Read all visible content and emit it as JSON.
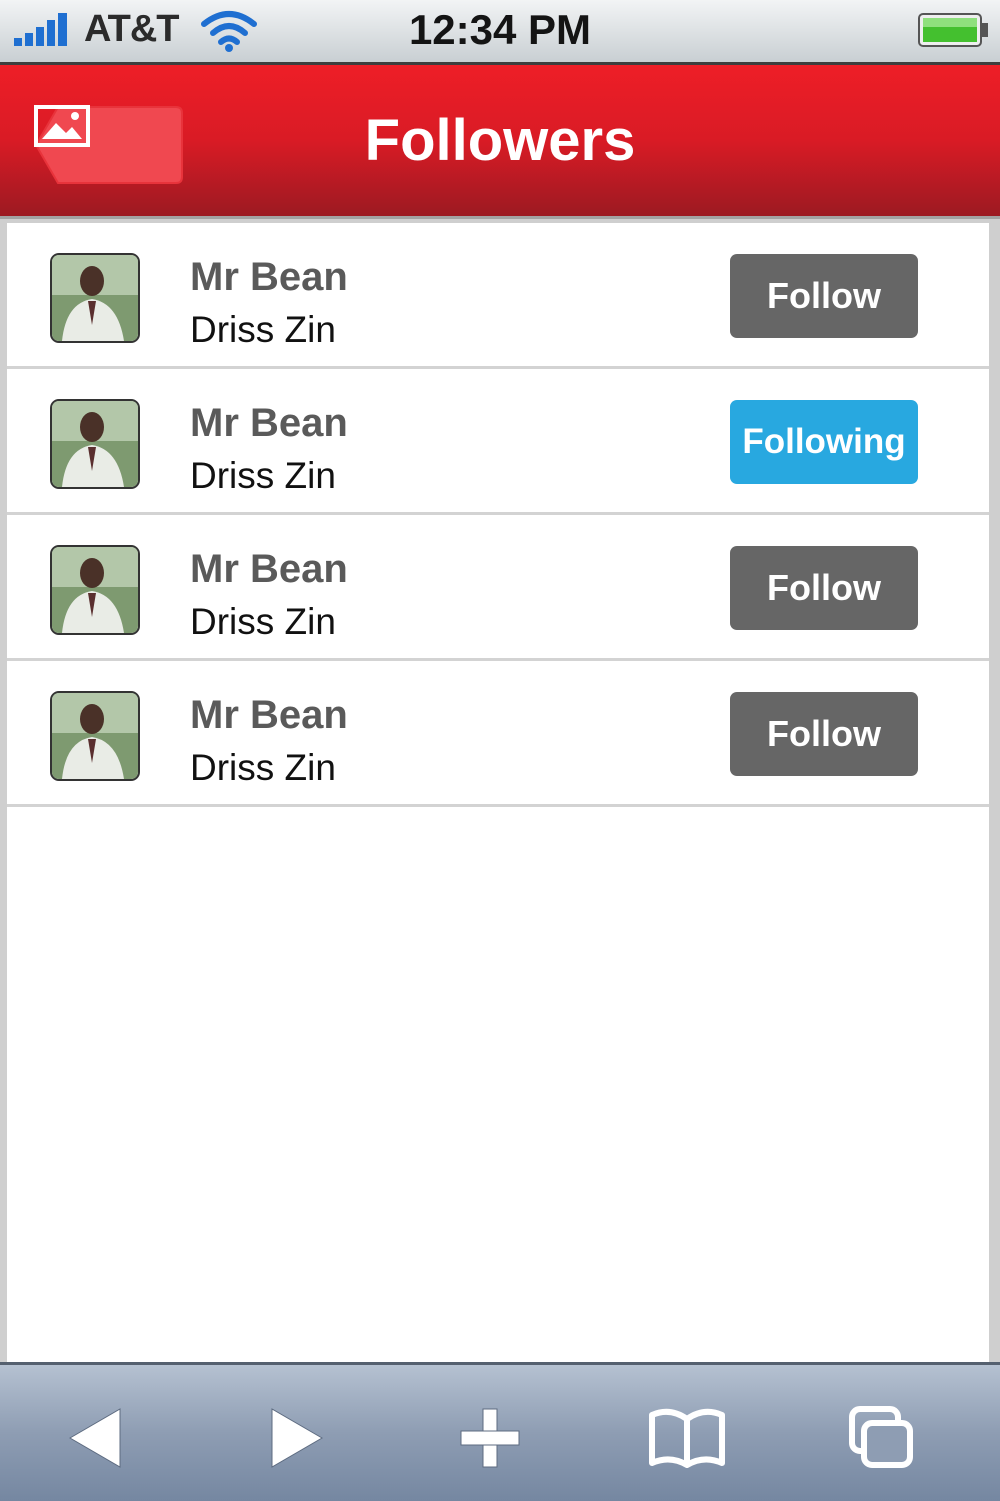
{
  "status_bar": {
    "carrier": "AT&T",
    "time": "12:34 PM",
    "signal_icon": "signal-bars-icon",
    "wifi_icon": "wifi-icon",
    "battery_icon": "battery-icon"
  },
  "nav": {
    "title": "Followers",
    "back_icon": "image-icon"
  },
  "followers": [
    {
      "name": "Mr Bean",
      "username": "Driss Zin",
      "button": "Follow",
      "following": false
    },
    {
      "name": "Mr Bean",
      "username": "Driss Zin",
      "button": "Following",
      "following": true
    },
    {
      "name": "Mr Bean",
      "username": "Driss Zin",
      "button": "Follow",
      "following": false
    },
    {
      "name": "Mr Bean",
      "username": "Driss Zin",
      "button": "Follow",
      "following": false
    }
  ],
  "toolbar": {
    "items": [
      "back-arrow-icon",
      "forward-arrow-icon",
      "plus-icon",
      "bookmarks-icon",
      "tabs-icon"
    ]
  },
  "colors": {
    "nav_red": "#e31b23",
    "follow_gray": "#666666",
    "following_blue": "#28a8e0",
    "toolbar_blue": "#8e9db3"
  }
}
